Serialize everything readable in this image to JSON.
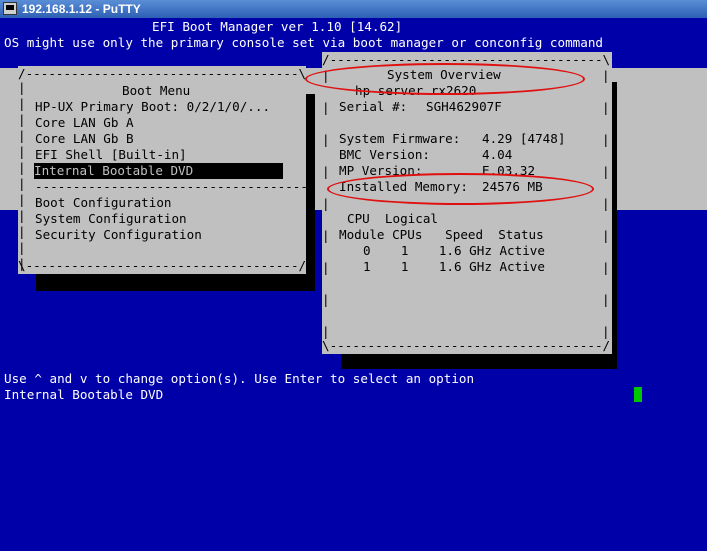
{
  "window": {
    "title": "192.168.1.12 - PuTTY"
  },
  "header": {
    "line1": "EFI Boot Manager ver 1.10 [14.62]",
    "line2": "OS might use only the primary console set via boot manager or conconfig command"
  },
  "boot_menu": {
    "border_top": "/------------------------------------\\",
    "title": "Boot Menu",
    "items": [
      "HP-UX Primary Boot: 0/2/1/0/...",
      "Core LAN Gb A",
      "Core LAN Gb B",
      "EFI Shell [Built-in]",
      "Internal Bootable DVD"
    ],
    "separator": "------------------------------------",
    "config_items": [
      "Boot Configuration",
      "System Configuration",
      "Security Configuration"
    ],
    "border_bottom": "\\------------------------------------/",
    "selected_index": 4
  },
  "system_overview": {
    "border_top": "/------------------------------------\\",
    "title": "System Overview",
    "model": "hp server rx2620",
    "serial_label": "Serial #:",
    "serial": "SGH462907F",
    "firmware_label": "System Firmware:",
    "firmware": "4.29 [4748]",
    "bmc_label": "BMC Version:",
    "bmc": "4.04",
    "mp_label": "MP Version:",
    "mp": "E.03.32",
    "memory_label": "Installed Memory:",
    "memory": "24576 MB",
    "cpu_header1": "CPU  Logical",
    "cpu_header2": "Module CPUs   Speed  Status",
    "cpu_rows": [
      "0    1    1.6 GHz Active",
      "1    1    1.6 GHz Active"
    ],
    "border_bottom": "\\------------------------------------/"
  },
  "footer": {
    "hint": "Use ^ and v to change option(s). Use Enter to select an option",
    "current": "Internal Bootable DVD"
  },
  "colors": {
    "background": "#0000a8",
    "panel": "#c0c0c0",
    "annotation": "#e01010",
    "cursor": "#00c800"
  }
}
